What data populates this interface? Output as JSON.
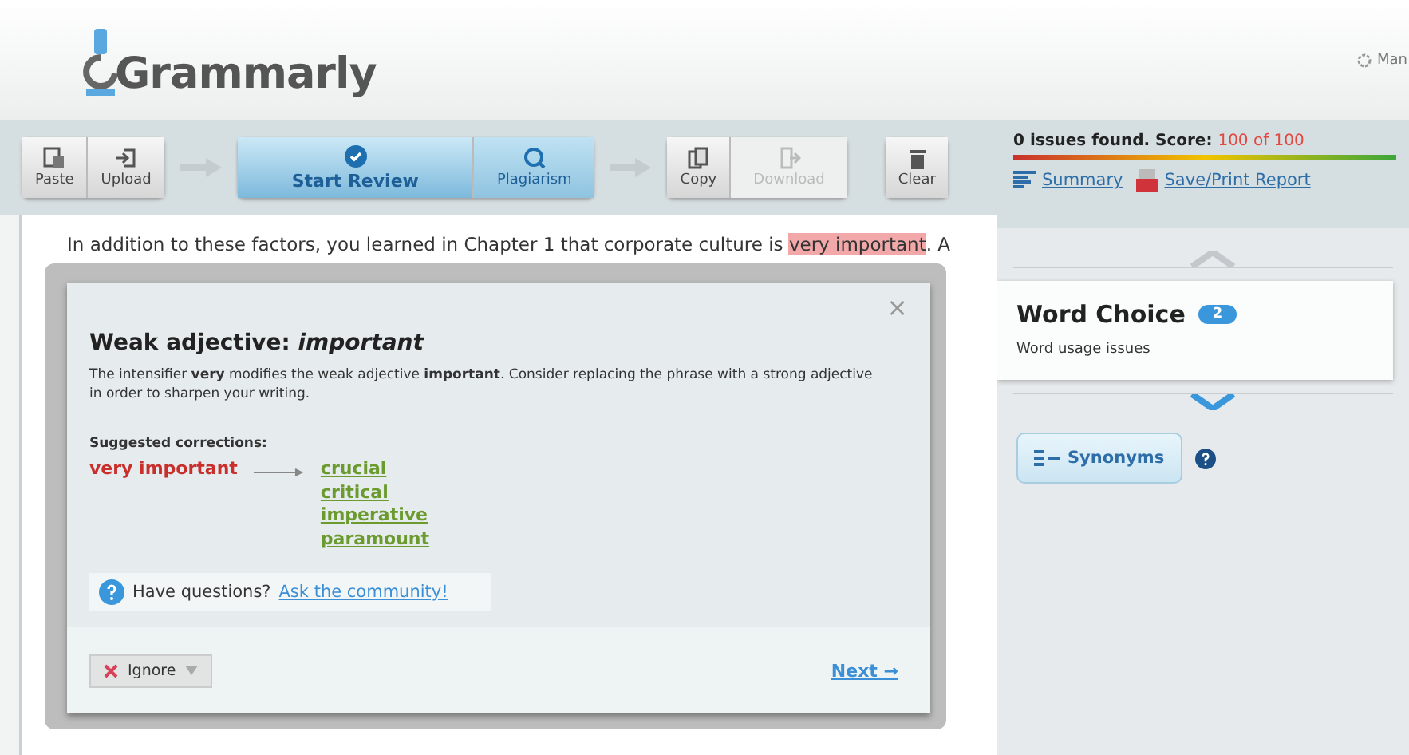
{
  "header": {
    "logo": "Grammarly",
    "account_link": "Man"
  },
  "toolbar": {
    "groups": [
      {
        "buttons": [
          {
            "label": "Paste",
            "kind": "paste",
            "selected": false,
            "disabled": false
          },
          {
            "label": "Upload",
            "kind": "upload",
            "selected": false,
            "disabled": false
          }
        ]
      },
      {
        "buttons": [
          {
            "label": "Start Review",
            "kind": "review",
            "selected": true,
            "disabled": false
          },
          {
            "label": "Plagiarism",
            "kind": "plagiarism",
            "selected": false,
            "disabled": false
          }
        ]
      },
      {
        "buttons": [
          {
            "label": "Copy",
            "kind": "copy",
            "selected": false,
            "disabled": false
          },
          {
            "label": "Download",
            "kind": "download",
            "selected": false,
            "disabled": true
          }
        ]
      },
      {
        "buttons": [
          {
            "label": "Clear",
            "kind": "clear",
            "selected": false,
            "disabled": false
          }
        ]
      }
    ]
  },
  "score": {
    "summary": "0 issues found. Score:",
    "value": "100 of 100"
  },
  "report_links": [
    {
      "label": "Summary",
      "kind": "summary"
    },
    {
      "label": "Save/Print Report",
      "kind": "pdf"
    }
  ],
  "editor": {
    "before": "In addition to these factors, you learned in Chapter 1 that corporate culture is",
    "highlight": "very important",
    "after": ". A"
  },
  "popup": {
    "close": "×",
    "title": "Weak adjective: *important*",
    "description": "The intensifier **very** modifies the weak adjective **important**. Consider replacing the phrase with a strong adjective in order to sharpen your writing.",
    "suggested_label": "Suggested corrections:",
    "original": "very important",
    "suggestions": [
      "crucial",
      "critical",
      "imperative",
      "paramount"
    ],
    "help_text": "Have questions?",
    "help_link": "Ask the community!",
    "ignore": "Ignore",
    "next": "Next →"
  },
  "sidebar": {
    "title": "Word Choice",
    "count": "2",
    "subtitle": "Word usage issues",
    "synonyms": "Synonyms"
  }
}
